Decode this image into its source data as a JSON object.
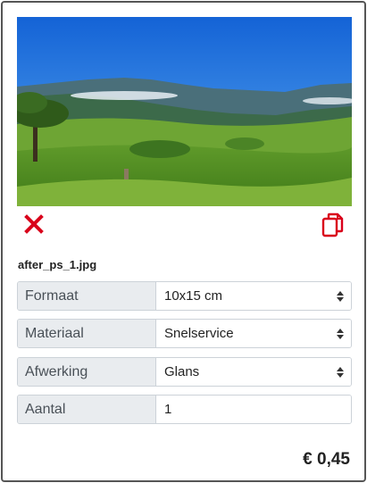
{
  "product": {
    "filename": "after_ps_1.jpg",
    "price": "€ 0,45"
  },
  "options": [
    {
      "label": "Formaat",
      "value": "10x15 cm",
      "type": "select"
    },
    {
      "label": "Materiaal",
      "value": "Snelservice",
      "type": "select"
    },
    {
      "label": "Afwerking",
      "value": "Glans",
      "type": "select"
    },
    {
      "label": "Aantal",
      "value": "1",
      "type": "input"
    }
  ],
  "icons": {
    "delete": "close-icon",
    "copy": "copy-icon",
    "caret": "sort-caret-icon"
  },
  "colors": {
    "accent": "#d9001b",
    "label_bg": "#e9ecef",
    "border": "#ccd2d8"
  }
}
